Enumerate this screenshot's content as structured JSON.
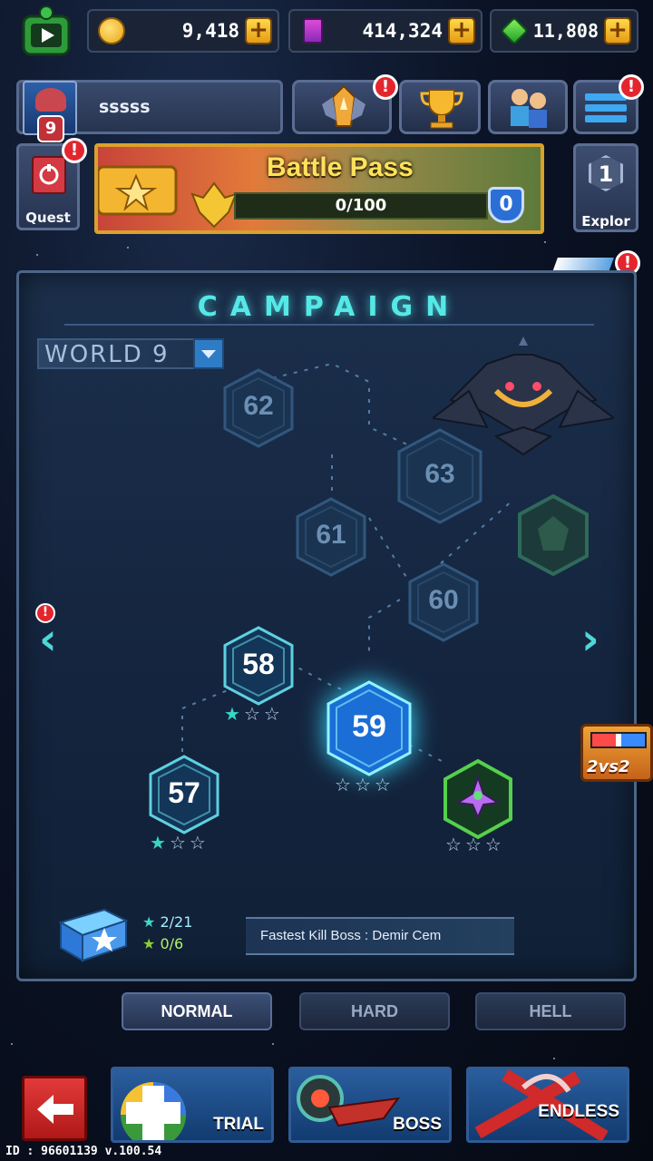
{
  "resources": {
    "gold": "9,418",
    "cards": "414,324",
    "gems": "11,808"
  },
  "profile": {
    "level": "9",
    "name": "sssss"
  },
  "quest": {
    "label": "Quest"
  },
  "explore": {
    "label": "Explor",
    "count": "1"
  },
  "battle_pass": {
    "title": "Battle Pass",
    "progress": "0/100",
    "level": "0",
    "progress_fraction": 0
  },
  "campaign": {
    "title": "CAMPAIGN",
    "world": "WORLD  9",
    "nodes": [
      {
        "label": "62",
        "state": "locked"
      },
      {
        "label": "63",
        "state": "locked"
      },
      {
        "label": "61",
        "state": "locked"
      },
      {
        "label": "60",
        "state": "locked"
      },
      {
        "label": "58",
        "state": "cleared",
        "stars_earned": 1
      },
      {
        "label": "59",
        "state": "current",
        "stars_earned": 0
      },
      {
        "label": "57",
        "state": "cleared",
        "stars_earned": 1
      }
    ],
    "stars_total": "2/21",
    "bonus_stars": "0/6",
    "fastest_kill": "Fastest Kill Boss : Demir Cem"
  },
  "event_badge": "2vs2",
  "modes": [
    {
      "label": "NORMAL",
      "active": true
    },
    {
      "label": "HARD",
      "active": false
    },
    {
      "label": "HELL",
      "active": false
    }
  ],
  "bottom": {
    "trial": "TRIAL",
    "boss": "BOSS",
    "endless": "ENDLESS"
  },
  "footer_id": "ID : 96601139 v.100.54",
  "colors": {
    "accent_cyan": "#55e8e6",
    "alert_red": "#e3262e",
    "gold": "#ffd94a",
    "gem_green": "#3ad04b"
  }
}
